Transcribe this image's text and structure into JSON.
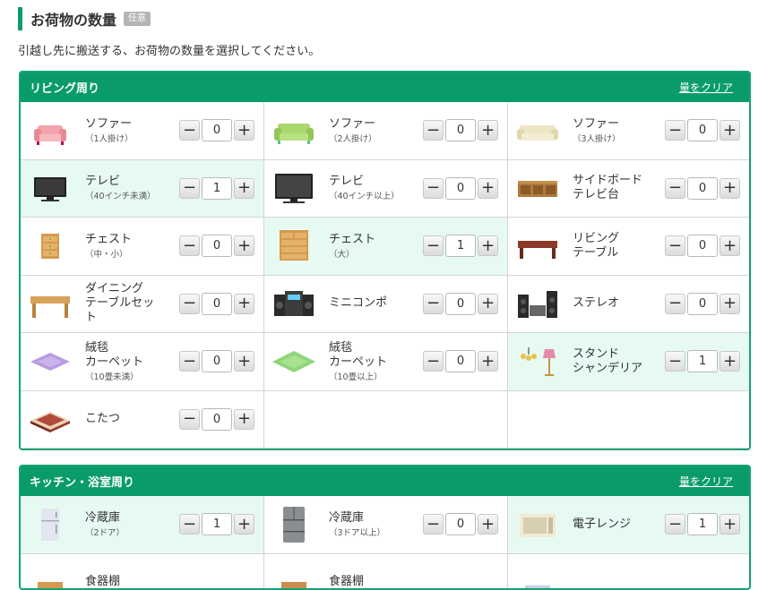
{
  "heading": {
    "title": "お荷物の数量",
    "badge": "任意"
  },
  "description": "引越し先に搬送する、お荷物の数量を選択してください。",
  "controls": {
    "minus": "−",
    "plus": "+"
  },
  "living": {
    "title": "リビング周り",
    "clear": "量をクリア",
    "items": [
      {
        "name": "ソファー",
        "sub": "（1人掛け）",
        "qty": "0",
        "icon": "sofa-1-icon",
        "highlight": false
      },
      {
        "name": "ソファー",
        "sub": "（2人掛け）",
        "qty": "0",
        "icon": "sofa-2-icon",
        "highlight": false
      },
      {
        "name": "ソファー",
        "sub": "（3人掛け）",
        "qty": "0",
        "icon": "sofa-3-icon",
        "highlight": false
      },
      {
        "name": "テレビ",
        "sub": "（40インチ未満）",
        "qty": "1",
        "icon": "tv-small-icon",
        "highlight": true
      },
      {
        "name": "テレビ",
        "sub": "（40インチ以上）",
        "qty": "0",
        "icon": "tv-large-icon",
        "highlight": false
      },
      {
        "name": "サイドボード\nテレビ台",
        "sub": "",
        "qty": "0",
        "icon": "sideboard-icon",
        "highlight": false
      },
      {
        "name": "チェスト",
        "sub": "（中・小）",
        "qty": "0",
        "icon": "chest-small-icon",
        "highlight": false
      },
      {
        "name": "チェスト",
        "sub": "（大）",
        "qty": "1",
        "icon": "chest-large-icon",
        "highlight": true
      },
      {
        "name": "リビング\nテーブル",
        "sub": "",
        "qty": "0",
        "icon": "living-table-icon",
        "highlight": false
      },
      {
        "name": "ダイニング\nテーブルセッ\nト",
        "sub": "",
        "qty": "0",
        "icon": "dining-table-icon",
        "highlight": false
      },
      {
        "name": "ミニコンポ",
        "sub": "",
        "qty": "0",
        "icon": "mini-stereo-icon",
        "highlight": false
      },
      {
        "name": "ステレオ",
        "sub": "",
        "qty": "0",
        "icon": "stereo-icon",
        "highlight": false
      },
      {
        "name": "絨毯\nカーペット",
        "sub": "（10畳未満）",
        "qty": "0",
        "icon": "carpet-small-icon",
        "highlight": false
      },
      {
        "name": "絨毯\nカーペット",
        "sub": "（10畳以上）",
        "qty": "0",
        "icon": "carpet-large-icon",
        "highlight": false
      },
      {
        "name": "スタンド\nシャンデリア",
        "sub": "",
        "qty": "1",
        "icon": "lamp-chandelier-icon",
        "highlight": true
      },
      {
        "name": "こたつ",
        "sub": "",
        "qty": "0",
        "icon": "kotatsu-icon",
        "highlight": false
      }
    ]
  },
  "kitchen": {
    "title": "キッチン・浴室周り",
    "clear": "量をクリア",
    "items": [
      {
        "name": "冷蔵庫",
        "sub": "（2ドア）",
        "qty": "1",
        "icon": "fridge-2door-icon",
        "highlight": true
      },
      {
        "name": "冷蔵庫",
        "sub": "（3ドア以上）",
        "qty": "0",
        "icon": "fridge-3door-icon",
        "highlight": false
      },
      {
        "name": "電子レンジ",
        "sub": "",
        "qty": "1",
        "icon": "microwave-icon",
        "highlight": true
      },
      {
        "name": "食器棚",
        "sub": "",
        "qty": "",
        "icon": "cupboard-icon",
        "highlight": false
      },
      {
        "name": "食器棚",
        "sub": "",
        "qty": "",
        "icon": "cupboard-large-icon",
        "highlight": false
      },
      {
        "name": "",
        "sub": "",
        "qty": "",
        "icon": "appliance-icon",
        "highlight": false
      }
    ]
  },
  "colors": {
    "accent": "#0a9b6c",
    "highlight_row": "#e6faf2",
    "badge": "#b5b5b5"
  }
}
